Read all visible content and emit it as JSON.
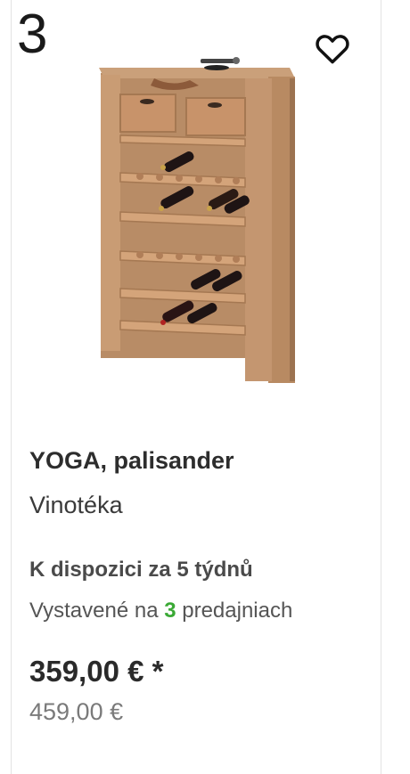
{
  "product": {
    "rank": "3",
    "wishlist_icon": "heart-outline-icon",
    "image_alt": "wine-rack-cabinet",
    "name": "YOGA, palisander",
    "category": "Vinotéka",
    "availability": "K dispozici za 5 týdnů",
    "stores_prefix": "Vystavené na ",
    "stores_count": "3",
    "stores_suffix": " predajniach",
    "price": "359,00 € *",
    "old_price": "459,00 €"
  },
  "colors": {
    "accent_green": "#3aa935",
    "text_dark": "#2b2b2b",
    "text_muted": "#7a7a7a",
    "wood": "#c89a72"
  }
}
